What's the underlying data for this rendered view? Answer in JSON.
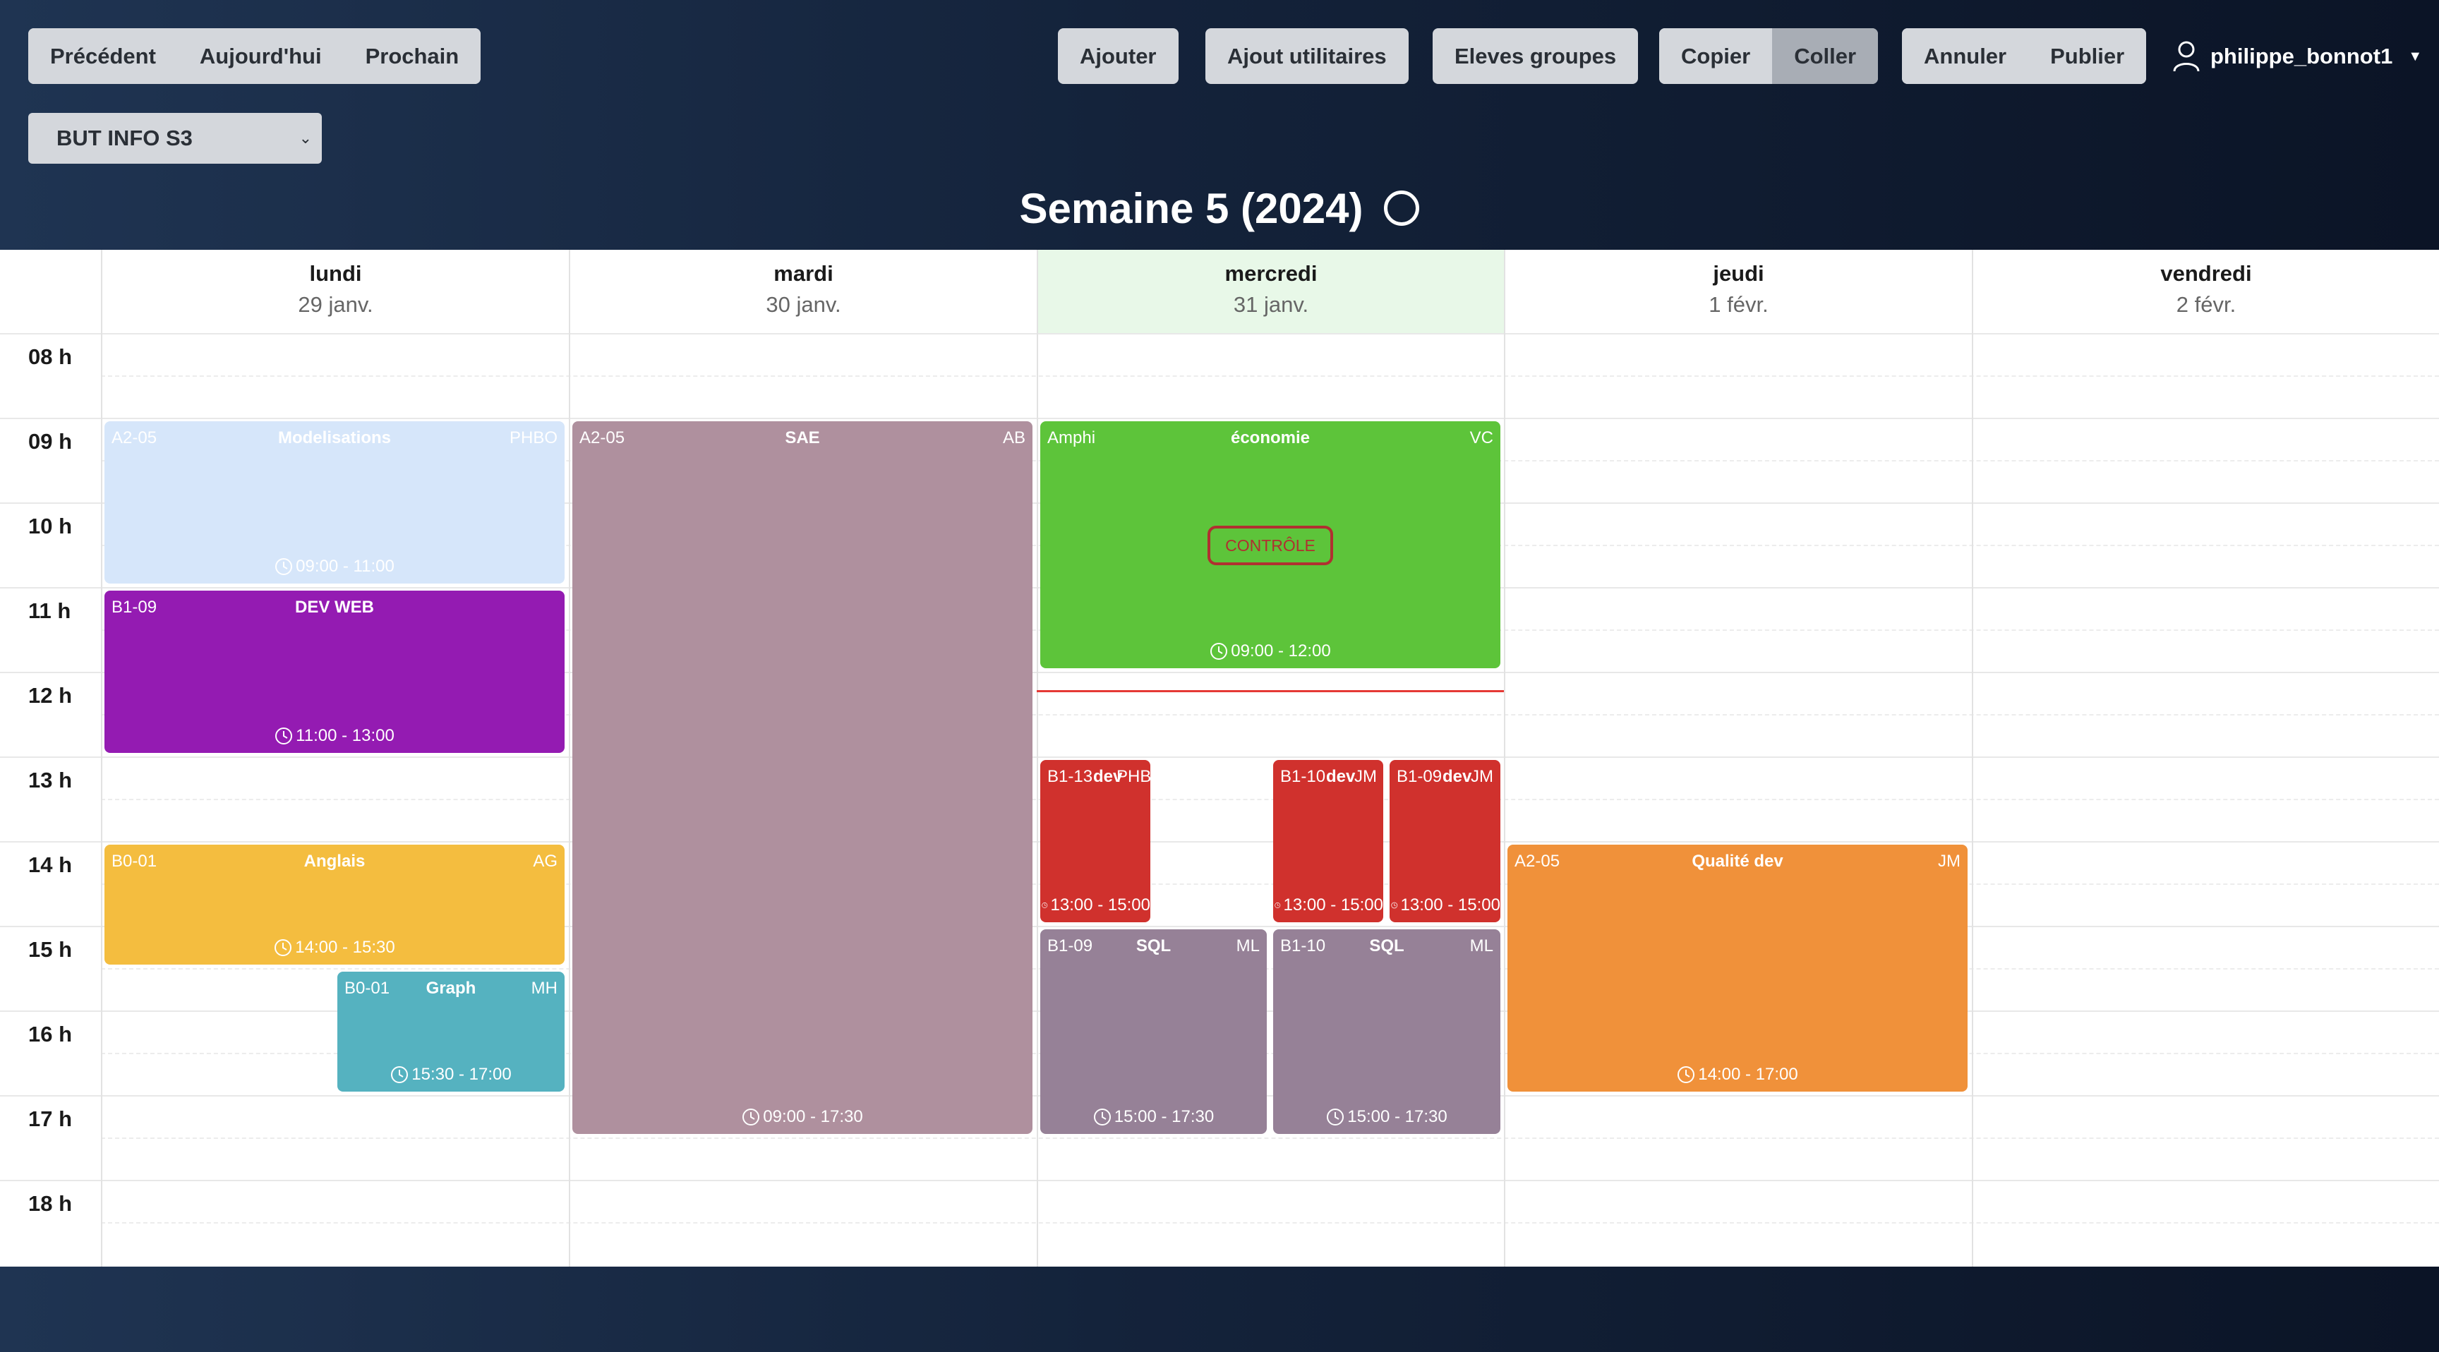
{
  "colors": {
    "header_bg": "#14233b",
    "modelisations": "#d6e6fa",
    "devweb": "#941bb2",
    "sae": "#af909e",
    "economie": "#5dc43a",
    "dev_red": "#d0312d",
    "sql": "#968197",
    "anglais": "#f4bd3f",
    "graph": "#55b2c0",
    "qualite": "#f0913a",
    "now_line": "#e53935",
    "controle": "#b03030"
  },
  "nav": {
    "prev": "Précédent",
    "today": "Aujourd'hui",
    "next": "Prochain"
  },
  "toolbar": {
    "ajouter": "Ajouter",
    "ajout_utilitaires": "Ajout utilitaires",
    "eleves_groupes": "Eleves groupes",
    "copier": "Copier",
    "coller": "Coller",
    "annuler": "Annuler",
    "publier": "Publier"
  },
  "user": {
    "icon": "user-icon",
    "name": "philippe_bonnot1"
  },
  "group_select": {
    "value": "BUT INFO S3"
  },
  "week": {
    "title": "Semaine 5 (2024)"
  },
  "days": [
    {
      "name": "lundi",
      "date": "29 janv."
    },
    {
      "name": "mardi",
      "date": "30 janv."
    },
    {
      "name": "mercredi",
      "date": "31 janv."
    },
    {
      "name": "jeudi",
      "date": "1 févr."
    },
    {
      "name": "vendredi",
      "date": "2 févr."
    }
  ],
  "hours": [
    "08 h",
    "09 h",
    "10 h",
    "11 h",
    "12 h",
    "13 h",
    "14 h",
    "15 h",
    "16 h",
    "17 h",
    "18 h"
  ],
  "events": {
    "modelisations": {
      "room": "A2-05",
      "title": "Modelisations",
      "prof": "PHBO",
      "time": "09:00 - 11:00"
    },
    "devweb": {
      "room": "B1-09",
      "title": "DEV WEB",
      "time": "11:00 - 13:00"
    },
    "anglais": {
      "room": "B0-01",
      "title": "Anglais",
      "prof": "AG",
      "time": "14:00 - 15:30"
    },
    "graph": {
      "room": "B0-01",
      "title": "Graph",
      "prof": "MH",
      "time": "15:30 - 17:00"
    },
    "sae": {
      "room": "A2-05",
      "title": "SAE",
      "prof": "AB",
      "time": "09:00 - 17:30"
    },
    "economie": {
      "room": "Amphi",
      "title": "économie",
      "prof": "VC",
      "time": "09:00 - 12:00",
      "badge": "CONTRÔLE"
    },
    "dev1": {
      "room": "B1-13",
      "title": "dev",
      "prof": "PHB",
      "time": "13:00 - 15:00"
    },
    "dev2": {
      "room": "B1-10",
      "title": "dev",
      "prof": "JM",
      "time": "13:00 - 15:00"
    },
    "dev3": {
      "room": "B1-09",
      "title": "dev",
      "prof": "JM",
      "time": "13:00 - 15:00"
    },
    "sql1": {
      "room": "B1-09",
      "title": "SQL",
      "prof": "ML",
      "time": "15:00 - 17:30"
    },
    "sql2": {
      "room": "B1-10",
      "title": "SQL",
      "prof": "ML",
      "time": "15:00 - 17:30"
    },
    "qualite": {
      "room": "A2-05",
      "title": "Qualité dev",
      "prof": "JM",
      "time": "14:00 - 17:00"
    }
  }
}
